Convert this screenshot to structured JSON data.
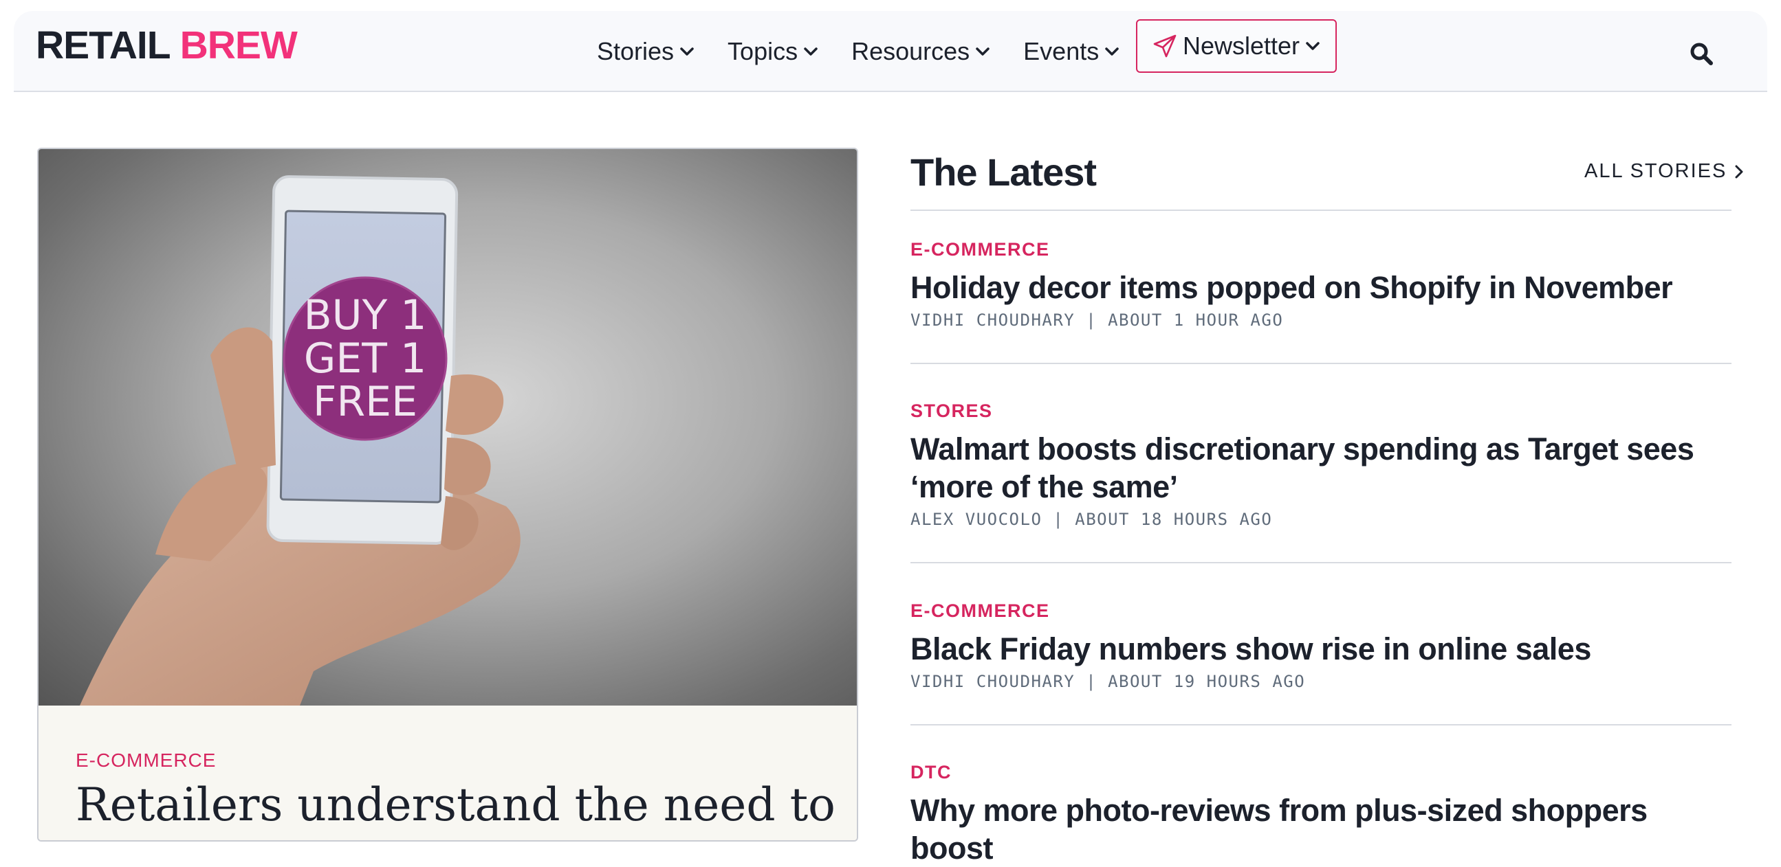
{
  "header": {
    "logo_part1": "RETAIL",
    "logo_part2": "BREW",
    "nav": [
      {
        "label": "Stories"
      },
      {
        "label": "Topics"
      },
      {
        "label": "Resources"
      },
      {
        "label": "Events"
      }
    ],
    "newsletter_label": "Newsletter"
  },
  "hero": {
    "image_text": [
      "BUY 1",
      "GET 1",
      "FREE"
    ],
    "category": "E-COMMERCE",
    "title": "Retailers understand the need to"
  },
  "latest": {
    "title": "The Latest",
    "all_stories": "ALL STORIES",
    "stories": [
      {
        "category": "E-COMMERCE",
        "title": "Holiday decor items popped on Shopify in November",
        "meta": "VIDHI CHOUDHARY | ABOUT 1 HOUR AGO"
      },
      {
        "category": "STORES",
        "title": "Walmart boosts discretionary spending as Target sees ‘more of the same’",
        "meta": "ALEX VUOCOLO | ABOUT 18 HOURS AGO"
      },
      {
        "category": "E-COMMERCE",
        "title": "Black Friday numbers show rise in online sales",
        "meta": "VIDHI CHOUDHARY | ABOUT 19 HOURS AGO"
      },
      {
        "category": "DTC",
        "title": "Why more photo-reviews from plus-sized shoppers boost",
        "meta": ""
      }
    ]
  },
  "colors": {
    "brand_pink": "#f2327a",
    "category_pink": "#d6255f",
    "text_dark": "#1c212c",
    "meta_gray": "#5f6b7a"
  },
  "icons": [
    "chevron-down-icon",
    "send-icon",
    "search-icon",
    "chevron-right-icon"
  ]
}
